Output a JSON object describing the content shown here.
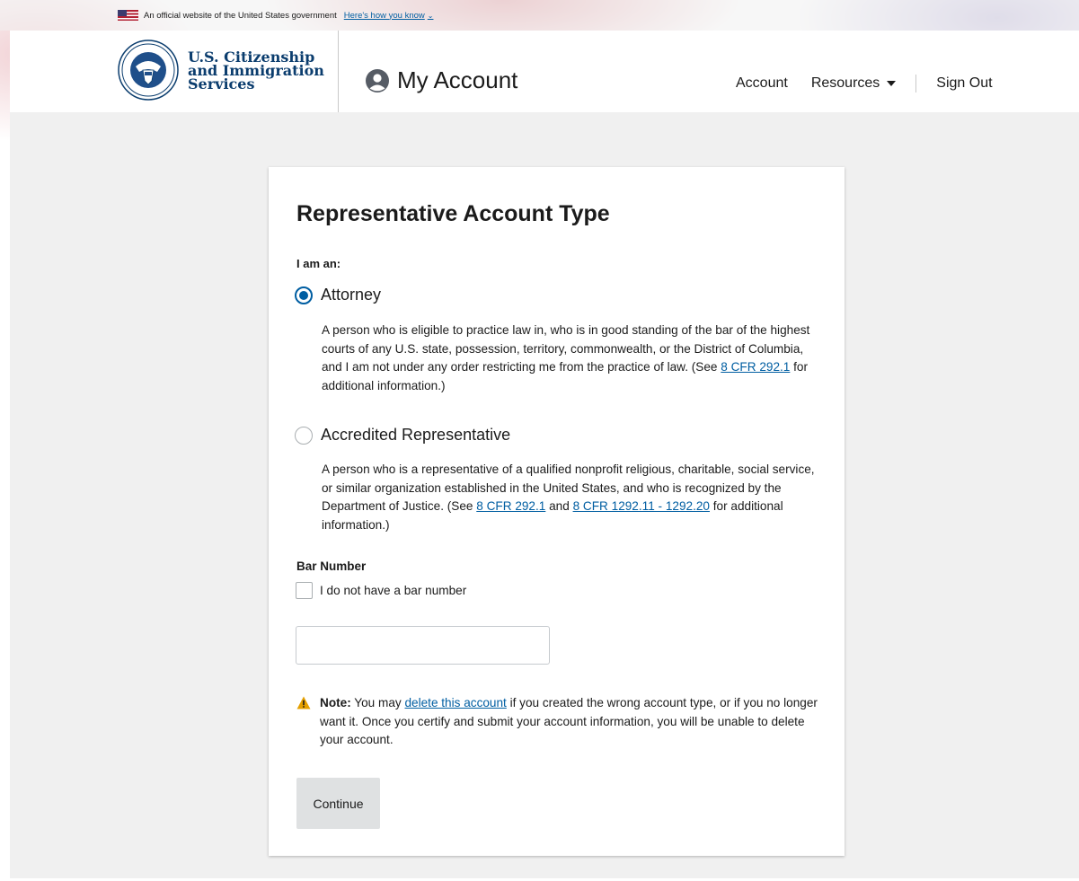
{
  "banner": {
    "official_text": "An official website of the United States government",
    "how_you_know_link": "Here's how you know"
  },
  "header": {
    "agency": {
      "line1": "U.S. Citizenship",
      "line2": "and Immigration",
      "line3": "Services"
    },
    "app_title": "My Account",
    "nav": {
      "account": "Account",
      "resources": "Resources",
      "sign_out": "Sign Out"
    }
  },
  "form": {
    "title": "Representative Account Type",
    "i_am_label": "I am an:",
    "options": [
      {
        "label": "Attorney",
        "selected": true,
        "desc_prefix": "A person who is eligible to practice law in, who is in good standing of the bar of the highest courts of any U.S. state, possession, territory, commonwealth, or the District of Columbia, and I am not under any order restricting me from the practice of law. (See ",
        "link1": "8 CFR 292.1",
        "desc_suffix": " for additional information.)"
      },
      {
        "label": "Accredited Representative",
        "selected": false,
        "desc_prefix": "A person who is a representative of a qualified nonprofit religious, charitable, social service, or similar organization established in the United States, and who is recognized by the Department of Justice. (See ",
        "link1": "8 CFR 292.1",
        "desc_middle": " and ",
        "link2": "8 CFR 1292.11 - 1292.20",
        "desc_suffix": " for additional information.)"
      }
    ],
    "bar_number_label": "Bar Number",
    "no_bar_number_label": "I do not have a bar number",
    "no_bar_number_checked": false,
    "bar_number_value": "",
    "note": {
      "strong": "Note:",
      "prefix": " You may ",
      "link": "delete this account",
      "suffix": " if you created the wrong account type, or if you no longer want it. Once you certify and submit your account information, you will be unable to delete your account."
    },
    "continue_label": "Continue"
  },
  "colors": {
    "primary": "#005ea2",
    "agency_navy": "#0b3d6e",
    "warning": "#e5a000",
    "page_bg": "#f0f0f0",
    "button_disabled": "#dfe1e2"
  },
  "icons": {
    "flag": "us-flag-icon",
    "seal": "dhs-seal-icon",
    "account": "account-circle-icon",
    "caret": "caret-down-icon",
    "warning": "warning-triangle-icon"
  }
}
